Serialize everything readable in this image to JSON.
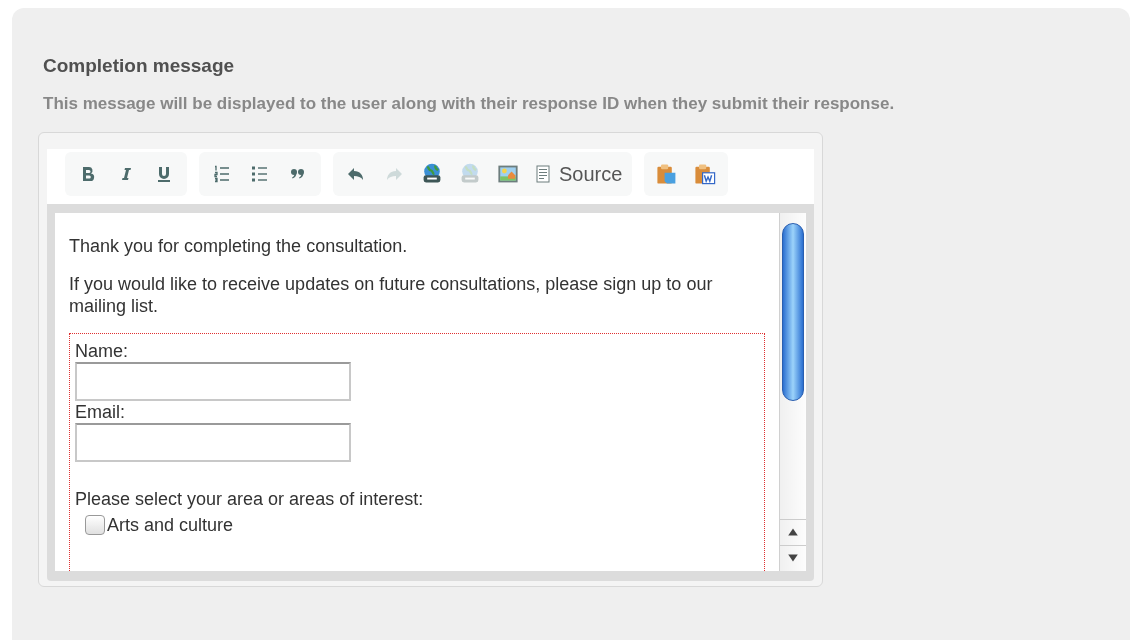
{
  "section": {
    "title": "Completion message",
    "description": "This message will be displayed to the user along with their response ID when they submit their response."
  },
  "toolbar": [
    [
      {
        "kind": "icon",
        "disabled": false
      },
      {
        "kind": "icon",
        "disabled": false
      },
      {
        "kind": "icon",
        "disabled": false
      }
    ],
    [
      {
        "kind": "icon",
        "disabled": false
      },
      {
        "kind": "icon",
        "disabled": false
      },
      {
        "kind": "icon",
        "disabled": false
      }
    ],
    [
      {
        "kind": "icon",
        "disabled": false
      },
      {
        "kind": "icon",
        "disabled": true
      },
      {
        "kind": "icon",
        "disabled": false
      },
      {
        "kind": "icon",
        "disabled": true
      },
      {
        "kind": "icon",
        "disabled": false
      },
      {
        "kind": "text",
        "label": "Source",
        "disabled": false
      }
    ],
    [
      {
        "kind": "icon",
        "disabled": false
      },
      {
        "kind": "icon",
        "disabled": false
      }
    ]
  ],
  "content": {
    "paragraphs": [
      "Thank you for completing the consultation.",
      "If you would like to receive updates on future consultations, please sign up to our mailing list."
    ],
    "form": {
      "fields": [
        {
          "label": "Name:"
        },
        {
          "label": "Email:"
        }
      ],
      "interest_prompt": "Please select your area or areas of interest:",
      "options": [
        {
          "label": "Arts and culture",
          "checked": false
        }
      ]
    }
  }
}
